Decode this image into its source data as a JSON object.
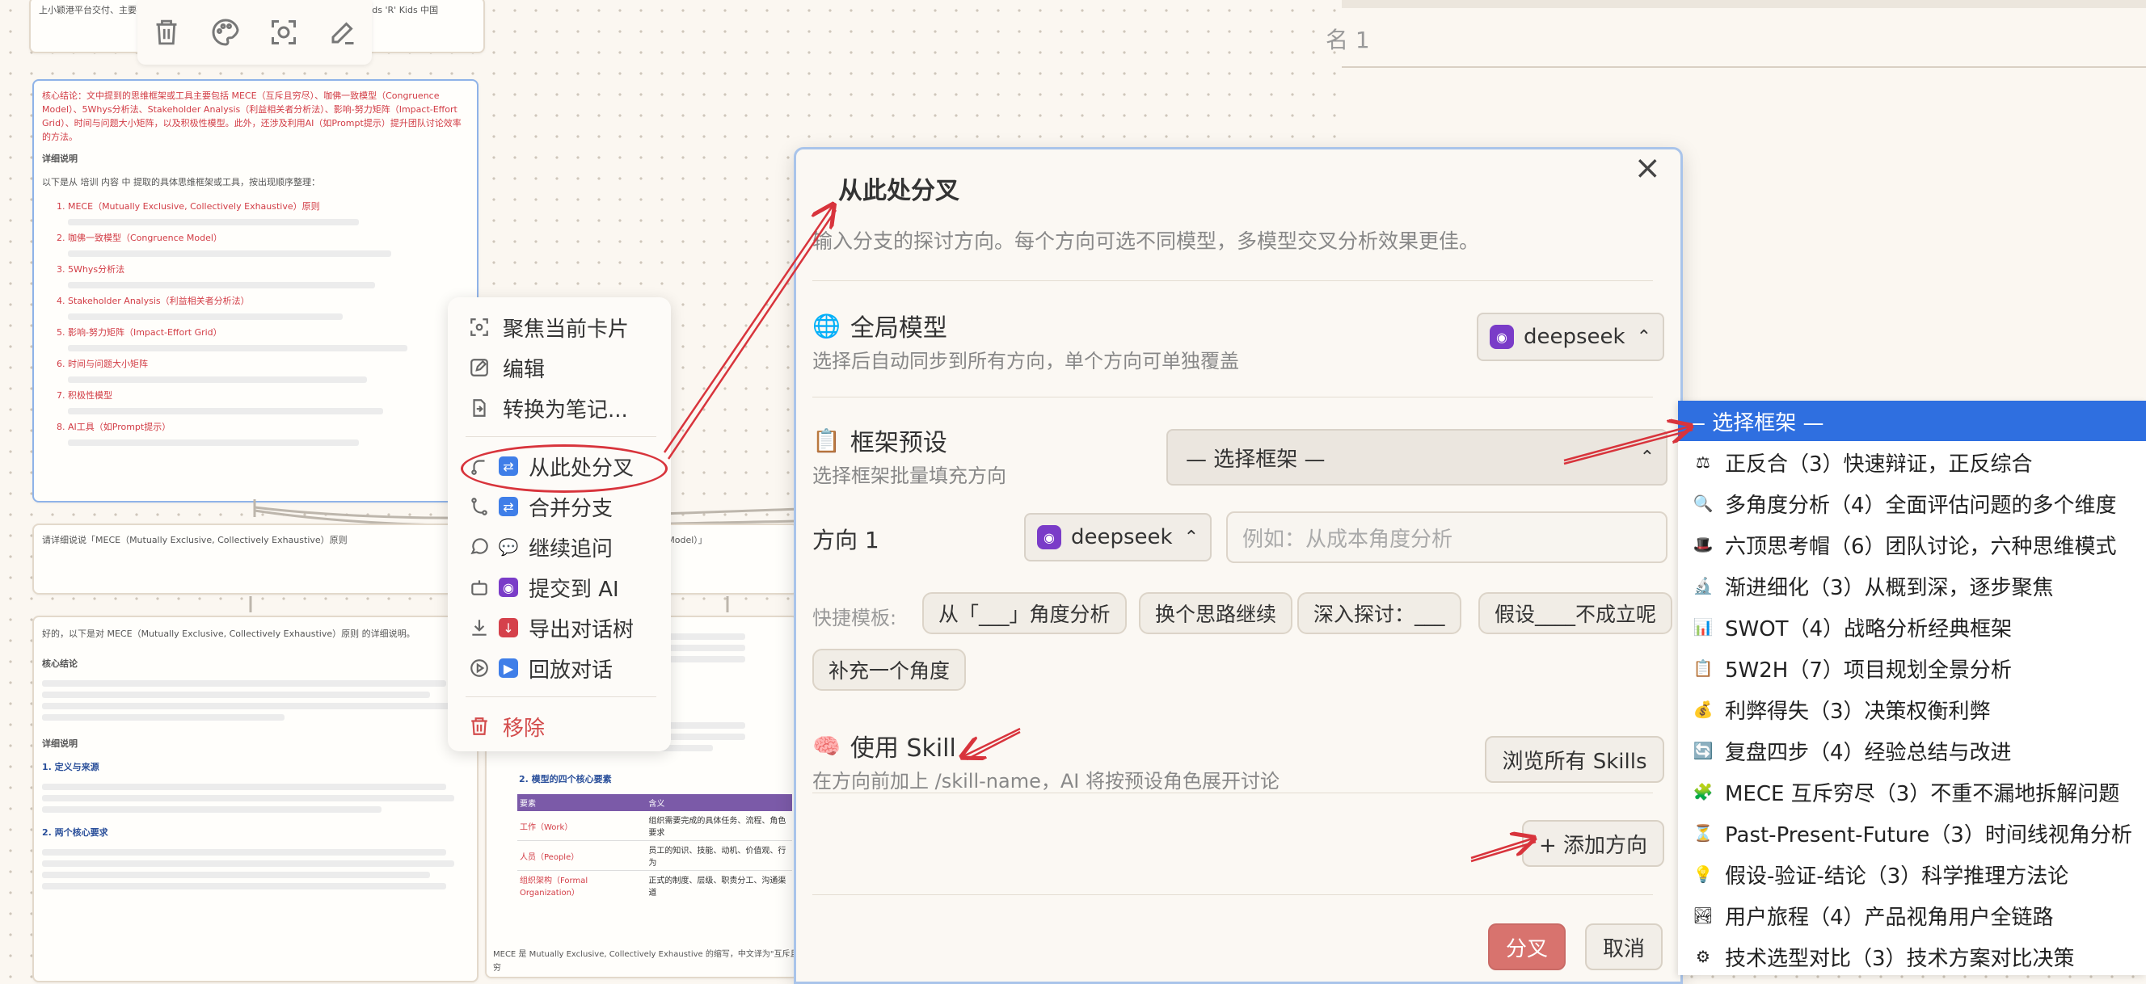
{
  "background": {
    "tab_fragment": "名 1"
  },
  "toolbar": {
    "icons": [
      "trash-icon",
      "palette-icon",
      "focus-icon",
      "edit-icon"
    ]
  },
  "cards": {
    "top_text": "上小颖港平台交付、主要… 看90天 增长AI数据制 … 察) 、美国食分冠亚大… 长、Kids 'R' Kids 中国",
    "sel_head": "核心结论：文中提到的思维框架或工具主要包括 MECE（互斥且穷尽）、咖佛一致模型（Congruence Model）、5Whys分析法、Stakeholder Analysis（利益相关者分析法）、影响-努力矩阵（Impact-Effort Grid）、时间与问题大小矩阵，以及积极性模型。此外，还涉及利用AI（如Prompt提示）提升团队讨论效率的方法。",
    "sel_detail_title": "详细说明",
    "sel_intro": "以下是从 培训 内容 中 提取的具体思维框架或工具，按出现顺序整理：",
    "sel_items": [
      "1. MECE（Mutually Exclusive, Collectively Exhaustive）原则",
      "2. 咖佛一致模型（Congruence Model）",
      "3. 5Whys分析法",
      "4. Stakeholder Analysis（利益相关者分析法）",
      "5. 影响-努力矩阵（Impact-Effort Grid）",
      "6. 时间与问题大小矩阵",
      "7. 积极性模型",
      "8. AI工具（如Prompt提示）"
    ],
    "mid_text": "请详细说说「MECE（Mutually Exclusive, Collectively Exhaustive）原则",
    "mid_right_text": "nce Model）」",
    "bot_head": "好的，以下是对 MECE（Mutually Exclusive, Collectively Exhaustive）原则 的详细说明。",
    "bot_core_title": "核心结论",
    "bot_detail_title": "详细说明",
    "bot_sub1": "1. 定义与来源",
    "bot_sub2": "2. 两个核心要求",
    "bot2_sub": "2. 模型的四个核心要素",
    "bot2_table_head": [
      "要素",
      "含义"
    ],
    "bot2_table_rows": [
      [
        "工作（Work）",
        "组织需要完成的具体任务、流程、角色要求"
      ],
      [
        "人员（People）",
        "员工的知识、技能、动机、价值观、行为"
      ],
      [
        "组织架构（Formal Organization）",
        "正式的制度、层级、职责分工、沟通渠道"
      ]
    ],
    "bot2_footer": "MECE 是 Mutually Exclusive, Collectively Exhaustive 的缩写，中文译为\"互斥且穷"
  },
  "context_menu": {
    "items": [
      {
        "label": "聚焦当前卡片",
        "icon": "focus-icon"
      },
      {
        "label": "编辑",
        "icon": "edit-icon"
      },
      {
        "label": "转换为笔记...",
        "icon": "convert-note-icon"
      },
      {
        "label": "从此处分叉",
        "icon": "branch-icon"
      },
      {
        "label": "合并分支",
        "icon": "merge-icon"
      },
      {
        "label": "继续追问",
        "icon": "chat-bubble-icon"
      },
      {
        "label": "提交到 AI",
        "icon": "bot-icon"
      },
      {
        "label": "导出对话树",
        "icon": "download-icon"
      },
      {
        "label": "回放对话",
        "icon": "play-icon"
      },
      {
        "label": "移除",
        "icon": "trash-icon"
      }
    ]
  },
  "dialog": {
    "title": "从此处分叉",
    "close": "×",
    "description": "输入分支的探讨方向。每个方向可选不同模型，多模型交叉分析效果更佳。",
    "global_model": {
      "title": "全局模型",
      "subtitle": "选择后自动同步到所有方向，单个方向可单独覆盖",
      "value": "deepseek"
    },
    "framework": {
      "title": "框架预设",
      "subtitle": "选择框架批量填充方向",
      "value": "— 选择框架 —"
    },
    "direction": {
      "label": "方向 1",
      "model": "deepseek",
      "placeholder": "例如：从成本角度分析"
    },
    "templates": {
      "label": "快捷模板:",
      "chips": [
        "从「___」角度分析",
        "换个思路继续",
        "深入探讨：___",
        "假设____不成立呢",
        "补充一个角度"
      ]
    },
    "skill": {
      "title": "使用 Skill",
      "subtitle": "在方向前加上 /skill-name，AI 将按预设角色展开讨论",
      "browse": "浏览所有 Skills"
    },
    "add_direction": "+ 添加方向",
    "confirm": "分叉",
    "cancel": "取消"
  },
  "framework_dropdown": {
    "items": [
      {
        "label": "— 选择框架 —",
        "icon": "",
        "selected": true
      },
      {
        "label": "正反合（3）快速辩证，正反综合",
        "icon": "scales-icon"
      },
      {
        "label": "多角度分析（4）全面评估问题的多个维度",
        "icon": "magnifier-icon"
      },
      {
        "label": "六顶思考帽（6）团队讨论，六种思维模式",
        "icon": "top-hat-icon"
      },
      {
        "label": "渐进细化（3）从概到深，逐步聚焦",
        "icon": "microscope-icon"
      },
      {
        "label": "SWOT（4）战略分析经典框架",
        "icon": "bar-chart-icon"
      },
      {
        "label": "5W2H（7）项目规划全景分析",
        "icon": "clipboard-icon"
      },
      {
        "label": "利弊得失（3）决策权衡利弊",
        "icon": "money-bag-icon"
      },
      {
        "label": "复盘四步（4）经验总结与改进",
        "icon": "cycle-icon"
      },
      {
        "label": "MECE 互斥穷尽（3）不重不漏地拆解问题",
        "icon": "puzzle-icon"
      },
      {
        "label": "Past-Present-Future（3）时间线视角分析",
        "icon": "hourglass-icon"
      },
      {
        "label": "假设-验证-结论（3）科学推理方法论",
        "icon": "bulb-icon"
      },
      {
        "label": "用户旅程（4）产品视角用户全链路",
        "icon": "landscape-icon"
      },
      {
        "label": "技术选型对比（3）技术方案对比决策",
        "icon": "gear-icon"
      }
    ]
  },
  "colors": {
    "accent_red": "#d23c45",
    "selected_blue": "#2f6fe0",
    "primary_button": "#d8736e"
  }
}
